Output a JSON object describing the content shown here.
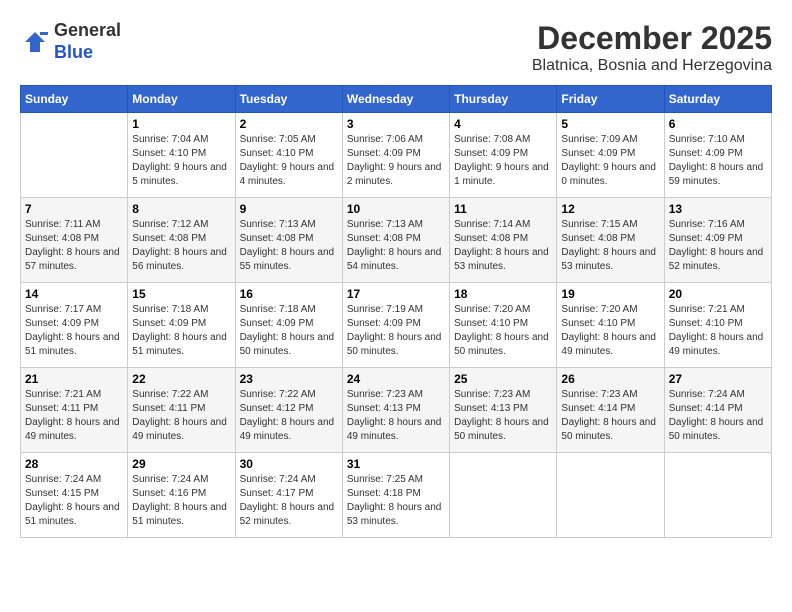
{
  "logo": {
    "general": "General",
    "blue": "Blue"
  },
  "header": {
    "month": "December 2025",
    "location": "Blatnica, Bosnia and Herzegovina"
  },
  "weekdays": [
    "Sunday",
    "Monday",
    "Tuesday",
    "Wednesday",
    "Thursday",
    "Friday",
    "Saturday"
  ],
  "weeks": [
    [
      {
        "day": "",
        "sunrise": "",
        "sunset": "",
        "daylight": ""
      },
      {
        "day": "1",
        "sunrise": "Sunrise: 7:04 AM",
        "sunset": "Sunset: 4:10 PM",
        "daylight": "Daylight: 9 hours and 5 minutes."
      },
      {
        "day": "2",
        "sunrise": "Sunrise: 7:05 AM",
        "sunset": "Sunset: 4:10 PM",
        "daylight": "Daylight: 9 hours and 4 minutes."
      },
      {
        "day": "3",
        "sunrise": "Sunrise: 7:06 AM",
        "sunset": "Sunset: 4:09 PM",
        "daylight": "Daylight: 9 hours and 2 minutes."
      },
      {
        "day": "4",
        "sunrise": "Sunrise: 7:08 AM",
        "sunset": "Sunset: 4:09 PM",
        "daylight": "Daylight: 9 hours and 1 minute."
      },
      {
        "day": "5",
        "sunrise": "Sunrise: 7:09 AM",
        "sunset": "Sunset: 4:09 PM",
        "daylight": "Daylight: 9 hours and 0 minutes."
      },
      {
        "day": "6",
        "sunrise": "Sunrise: 7:10 AM",
        "sunset": "Sunset: 4:09 PM",
        "daylight": "Daylight: 8 hours and 59 minutes."
      }
    ],
    [
      {
        "day": "7",
        "sunrise": "Sunrise: 7:11 AM",
        "sunset": "Sunset: 4:08 PM",
        "daylight": "Daylight: 8 hours and 57 minutes."
      },
      {
        "day": "8",
        "sunrise": "Sunrise: 7:12 AM",
        "sunset": "Sunset: 4:08 PM",
        "daylight": "Daylight: 8 hours and 56 minutes."
      },
      {
        "day": "9",
        "sunrise": "Sunrise: 7:13 AM",
        "sunset": "Sunset: 4:08 PM",
        "daylight": "Daylight: 8 hours and 55 minutes."
      },
      {
        "day": "10",
        "sunrise": "Sunrise: 7:13 AM",
        "sunset": "Sunset: 4:08 PM",
        "daylight": "Daylight: 8 hours and 54 minutes."
      },
      {
        "day": "11",
        "sunrise": "Sunrise: 7:14 AM",
        "sunset": "Sunset: 4:08 PM",
        "daylight": "Daylight: 8 hours and 53 minutes."
      },
      {
        "day": "12",
        "sunrise": "Sunrise: 7:15 AM",
        "sunset": "Sunset: 4:08 PM",
        "daylight": "Daylight: 8 hours and 53 minutes."
      },
      {
        "day": "13",
        "sunrise": "Sunrise: 7:16 AM",
        "sunset": "Sunset: 4:09 PM",
        "daylight": "Daylight: 8 hours and 52 minutes."
      }
    ],
    [
      {
        "day": "14",
        "sunrise": "Sunrise: 7:17 AM",
        "sunset": "Sunset: 4:09 PM",
        "daylight": "Daylight: 8 hours and 51 minutes."
      },
      {
        "day": "15",
        "sunrise": "Sunrise: 7:18 AM",
        "sunset": "Sunset: 4:09 PM",
        "daylight": "Daylight: 8 hours and 51 minutes."
      },
      {
        "day": "16",
        "sunrise": "Sunrise: 7:18 AM",
        "sunset": "Sunset: 4:09 PM",
        "daylight": "Daylight: 8 hours and 50 minutes."
      },
      {
        "day": "17",
        "sunrise": "Sunrise: 7:19 AM",
        "sunset": "Sunset: 4:09 PM",
        "daylight": "Daylight: 8 hours and 50 minutes."
      },
      {
        "day": "18",
        "sunrise": "Sunrise: 7:20 AM",
        "sunset": "Sunset: 4:10 PM",
        "daylight": "Daylight: 8 hours and 50 minutes."
      },
      {
        "day": "19",
        "sunrise": "Sunrise: 7:20 AM",
        "sunset": "Sunset: 4:10 PM",
        "daylight": "Daylight: 8 hours and 49 minutes."
      },
      {
        "day": "20",
        "sunrise": "Sunrise: 7:21 AM",
        "sunset": "Sunset: 4:10 PM",
        "daylight": "Daylight: 8 hours and 49 minutes."
      }
    ],
    [
      {
        "day": "21",
        "sunrise": "Sunrise: 7:21 AM",
        "sunset": "Sunset: 4:11 PM",
        "daylight": "Daylight: 8 hours and 49 minutes."
      },
      {
        "day": "22",
        "sunrise": "Sunrise: 7:22 AM",
        "sunset": "Sunset: 4:11 PM",
        "daylight": "Daylight: 8 hours and 49 minutes."
      },
      {
        "day": "23",
        "sunrise": "Sunrise: 7:22 AM",
        "sunset": "Sunset: 4:12 PM",
        "daylight": "Daylight: 8 hours and 49 minutes."
      },
      {
        "day": "24",
        "sunrise": "Sunrise: 7:23 AM",
        "sunset": "Sunset: 4:13 PM",
        "daylight": "Daylight: 8 hours and 49 minutes."
      },
      {
        "day": "25",
        "sunrise": "Sunrise: 7:23 AM",
        "sunset": "Sunset: 4:13 PM",
        "daylight": "Daylight: 8 hours and 50 minutes."
      },
      {
        "day": "26",
        "sunrise": "Sunrise: 7:23 AM",
        "sunset": "Sunset: 4:14 PM",
        "daylight": "Daylight: 8 hours and 50 minutes."
      },
      {
        "day": "27",
        "sunrise": "Sunrise: 7:24 AM",
        "sunset": "Sunset: 4:14 PM",
        "daylight": "Daylight: 8 hours and 50 minutes."
      }
    ],
    [
      {
        "day": "28",
        "sunrise": "Sunrise: 7:24 AM",
        "sunset": "Sunset: 4:15 PM",
        "daylight": "Daylight: 8 hours and 51 minutes."
      },
      {
        "day": "29",
        "sunrise": "Sunrise: 7:24 AM",
        "sunset": "Sunset: 4:16 PM",
        "daylight": "Daylight: 8 hours and 51 minutes."
      },
      {
        "day": "30",
        "sunrise": "Sunrise: 7:24 AM",
        "sunset": "Sunset: 4:17 PM",
        "daylight": "Daylight: 8 hours and 52 minutes."
      },
      {
        "day": "31",
        "sunrise": "Sunrise: 7:25 AM",
        "sunset": "Sunset: 4:18 PM",
        "daylight": "Daylight: 8 hours and 53 minutes."
      },
      {
        "day": "",
        "sunrise": "",
        "sunset": "",
        "daylight": ""
      },
      {
        "day": "",
        "sunrise": "",
        "sunset": "",
        "daylight": ""
      },
      {
        "day": "",
        "sunrise": "",
        "sunset": "",
        "daylight": ""
      }
    ]
  ]
}
